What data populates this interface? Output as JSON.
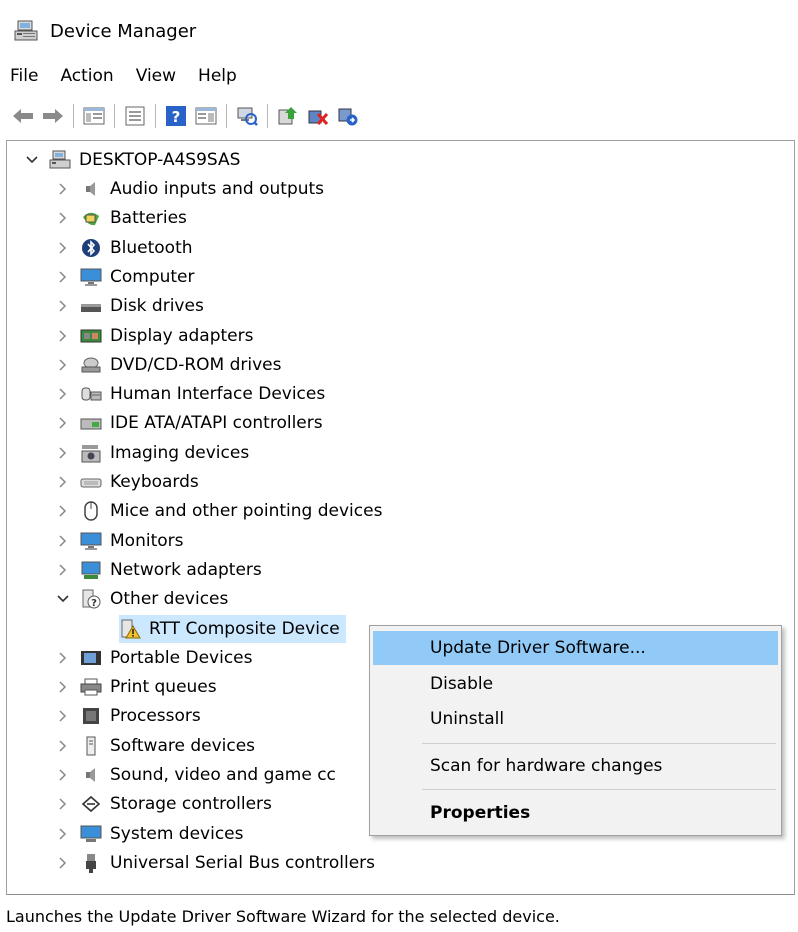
{
  "window": {
    "title": "Device Manager",
    "app_icon": "device-manager-icon"
  },
  "menu": {
    "items": [
      "File",
      "Action",
      "View",
      "Help"
    ]
  },
  "toolbar": {
    "buttons": [
      "back-arrow-icon",
      "forward-arrow-icon",
      "show-hide-console-tree-icon",
      "properties-sheet-icon",
      "help-icon",
      "action-pane-icon",
      "scan-hardware-icon",
      "update-driver-icon",
      "disable-device-icon",
      "uninstall-device-icon"
    ]
  },
  "tree": {
    "root": {
      "label": "DESKTOP-A4S9SAS",
      "expanded": true,
      "icon": "computer-root-icon"
    },
    "categories": [
      {
        "label": "Audio inputs and outputs",
        "icon": "speaker-icon",
        "expanded": false
      },
      {
        "label": "Batteries",
        "icon": "battery-icon",
        "expanded": false
      },
      {
        "label": "Bluetooth",
        "icon": "bluetooth-icon",
        "expanded": false
      },
      {
        "label": "Computer",
        "icon": "monitor-icon",
        "expanded": false
      },
      {
        "label": "Disk drives",
        "icon": "disk-drive-icon",
        "expanded": false
      },
      {
        "label": "Display adapters",
        "icon": "display-adapter-icon",
        "expanded": false
      },
      {
        "label": "DVD/CD-ROM drives",
        "icon": "dvd-drive-icon",
        "expanded": false
      },
      {
        "label": "Human Interface Devices",
        "icon": "hid-icon",
        "expanded": false
      },
      {
        "label": "IDE ATA/ATAPI controllers",
        "icon": "ide-controller-icon",
        "expanded": false
      },
      {
        "label": "Imaging devices",
        "icon": "camera-icon",
        "expanded": false
      },
      {
        "label": "Keyboards",
        "icon": "keyboard-icon",
        "expanded": false
      },
      {
        "label": "Mice and other pointing devices",
        "icon": "mouse-icon",
        "expanded": false
      },
      {
        "label": "Monitors",
        "icon": "monitor-icon",
        "expanded": false
      },
      {
        "label": "Network adapters",
        "icon": "network-adapter-icon",
        "expanded": false
      },
      {
        "label": "Other devices",
        "icon": "unknown-device-icon",
        "expanded": true
      },
      {
        "label": "RTT Composite Device",
        "icon": "warning-device-icon",
        "child": true,
        "selected": true
      },
      {
        "label": "Portable Devices",
        "icon": "portable-device-icon",
        "expanded": false
      },
      {
        "label": "Print queues",
        "icon": "printer-icon",
        "expanded": false
      },
      {
        "label": "Processors",
        "icon": "processor-icon",
        "expanded": false
      },
      {
        "label": "Software devices",
        "icon": "software-device-icon",
        "expanded": false
      },
      {
        "label": "Sound, video and game cc",
        "icon": "speaker-icon",
        "expanded": false
      },
      {
        "label": "Storage controllers",
        "icon": "storage-controller-icon",
        "expanded": false
      },
      {
        "label": "System devices",
        "icon": "system-device-icon",
        "expanded": false
      },
      {
        "label": "Universal Serial Bus controllers",
        "icon": "usb-icon",
        "expanded": false
      }
    ]
  },
  "context_menu": {
    "items": [
      {
        "label": "Update Driver Software...",
        "highlighted": true,
        "bold": false
      },
      {
        "label": "Disable",
        "highlighted": false,
        "bold": false
      },
      {
        "label": "Uninstall",
        "highlighted": false,
        "bold": false
      },
      {
        "label": "Scan for hardware changes",
        "highlighted": false,
        "bold": false
      },
      {
        "label": "Properties",
        "highlighted": false,
        "bold": true
      }
    ]
  },
  "status": {
    "text": "Launches the Update Driver Software Wizard for the selected device."
  },
  "colors": {
    "selection": "#cce8ff",
    "menu_highlight": "#91c9f7",
    "menu_bg": "#f2f2f2"
  }
}
